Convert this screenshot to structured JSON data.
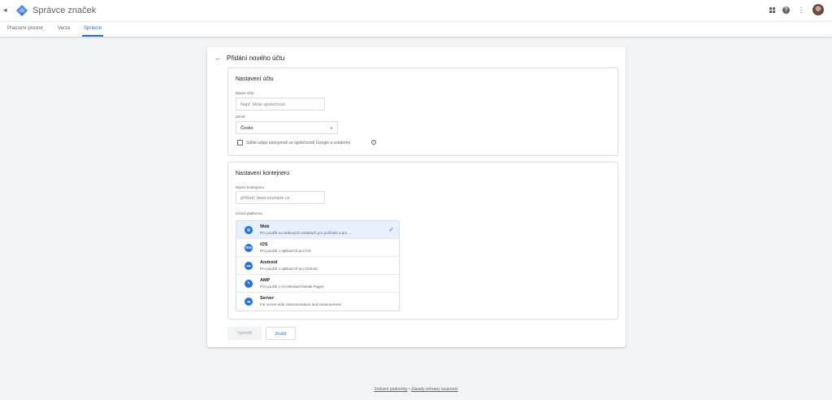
{
  "app": {
    "title": "Správce značek",
    "accent": "#1a73e8"
  },
  "tabs": [
    {
      "label": "Pracovní prostor"
    },
    {
      "label": "Verze"
    },
    {
      "label": "Správce"
    }
  ],
  "page": {
    "title": "Přidání nového účtu"
  },
  "account": {
    "title": "Nastavení účtu",
    "name_label": "Název účtu",
    "name_placeholder": "Např. Moje společnost",
    "country_label": "Země",
    "country_value": "Česko",
    "share_label": "Sdílet údaje anonymně se společností Google a ostatními"
  },
  "container": {
    "title": "Nastavení kontejneru",
    "name_label": "Název kontejneru",
    "name_placeholder": "příklad: www.example.cz",
    "platform_label": "Cílová platforma",
    "platforms": [
      {
        "name": "Web",
        "desc": "Pro použití na webových stránkách pro počítače a pro ...",
        "icon": "globe-icon"
      },
      {
        "name": "iOS",
        "desc": "Pro použití v aplikacích pro iOS",
        "icon": "ios-icon"
      },
      {
        "name": "Android",
        "desc": "Pro použití v aplikacích pro Android",
        "icon": "android-icon"
      },
      {
        "name": "AMP",
        "desc": "Pro použití v Accelerated Mobile Pages",
        "icon": "amp-icon"
      },
      {
        "name": "Server",
        "desc": "For server-side instrumentation and measurement",
        "icon": "cloud-icon"
      }
    ]
  },
  "buttons": {
    "create": "Vytvořit",
    "cancel": "Zrušit"
  },
  "footer": {
    "terms": "Smluvní podmínky",
    "separator": "•",
    "privacy": "Zásady ochrany soukromí"
  }
}
